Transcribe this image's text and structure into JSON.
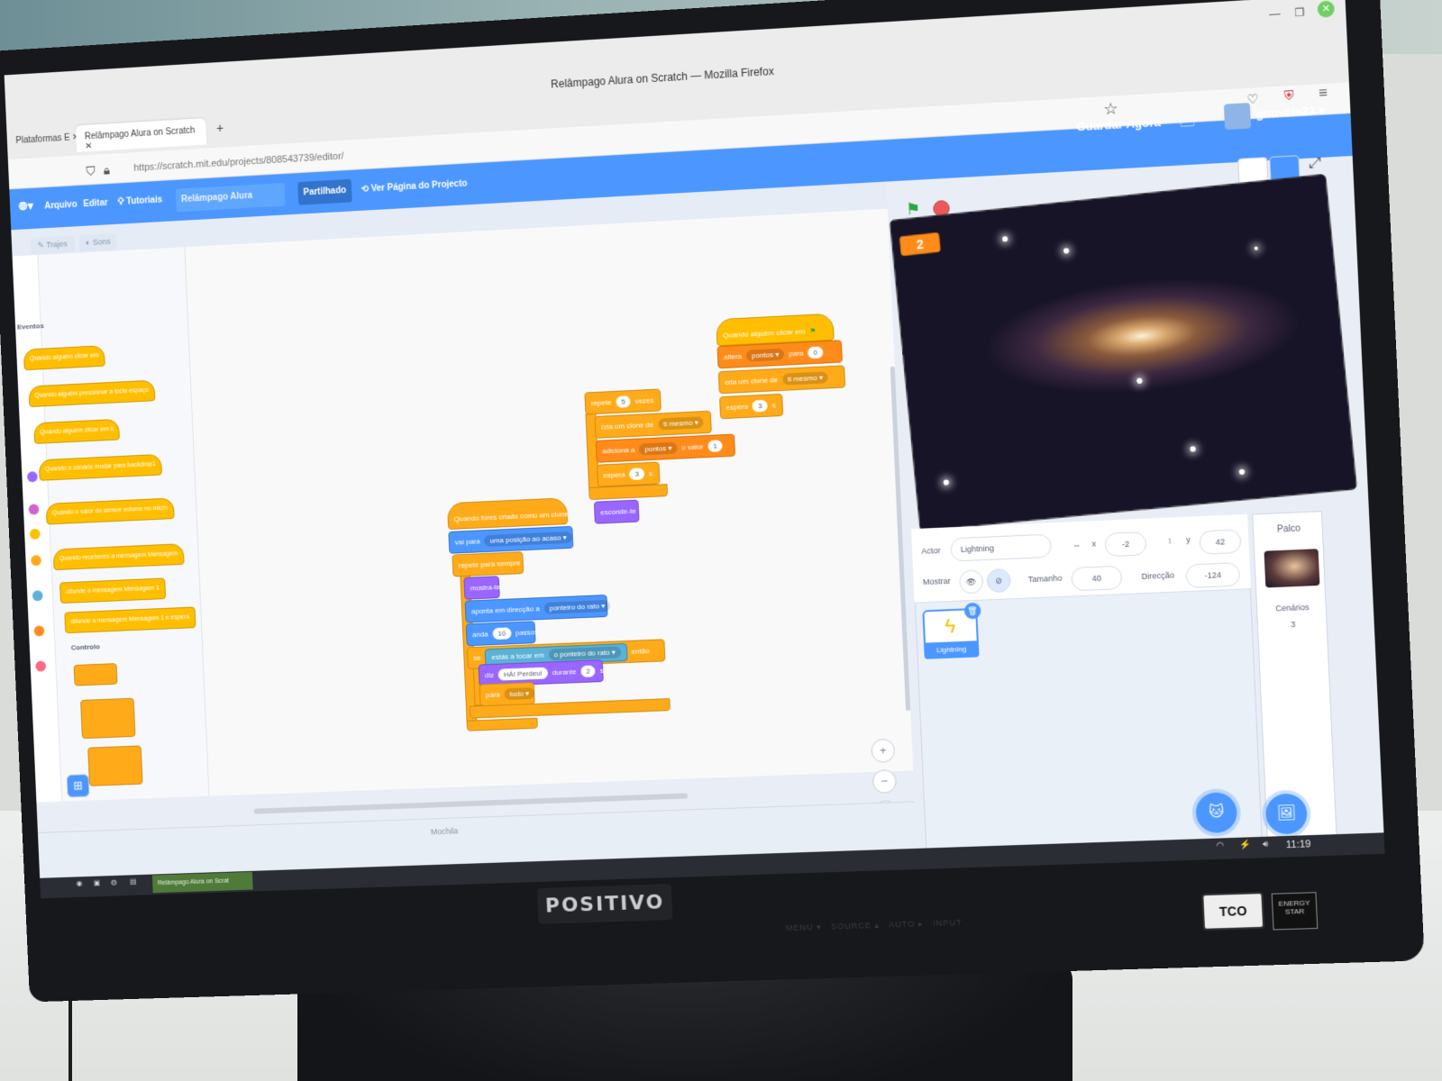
{
  "browser": {
    "window_title": "Relâmpago Alura on Scratch — Mozilla Firefox",
    "tabs": [
      {
        "label": "Plataformas E"
      },
      {
        "label": "Relâmpago Alura on Scratch"
      }
    ],
    "new_tab": "+",
    "url": "https://scratch.mit.edu/projects/808543739/editor/"
  },
  "menubar": {
    "file": "Arquivo",
    "edit": "Editar",
    "tutorials": "Tutoriais",
    "project_title": "Relâmpago Alura",
    "share": "Partilhado",
    "see_page": "Ver Página do Projecto",
    "save_now": "Guardar Agora",
    "username": "gouveia23"
  },
  "editor_tabs": {
    "costumes": "Trajes",
    "sounds": "Sons"
  },
  "palette": {
    "events_label": "Eventos",
    "control_label": "Controlo",
    "events_blocks": [
      "Quando alguém clicar em",
      "Quando alguém pressionar a tecla espaço",
      "Quando alguém clicar em ti",
      "Quando o cenário mudar para backdrop1",
      "Quando o valor do sensor volume no micro",
      "Quando receberes a mensagem Mensagem",
      "difunde a mensagem Mensagem 1",
      "difunde a mensagem Mensagem 1 e espera"
    ],
    "category_labels": [
      "Aparência",
      "Som",
      "Eventos",
      "Controlo",
      "Sensores",
      "Variáveis",
      "Os Meus Blocos"
    ]
  },
  "scripts": {
    "s1": {
      "hat": "Quando alguém clicar em",
      "set_var": "altera",
      "set_var_name": "pontos",
      "set_to": "para",
      "set_value": "0",
      "clone": "cria um clone de",
      "clone_target": "ti mesmo",
      "wait": "espera",
      "wait_value": "3",
      "wait_unit": "s"
    },
    "s2": {
      "repeat": "repete",
      "repeat_value": "5",
      "repeat_unit": "vezes",
      "clone": "cria um clone de",
      "clone_target": "ti mesmo",
      "change": "adiciona a",
      "change_var": "pontos",
      "change_mid": "o valor",
      "change_value": "1",
      "wait": "espera",
      "wait_value": "3",
      "wait_unit": "s",
      "hide": "esconde-te"
    },
    "s3": {
      "hat": "Quando fores criado como um clone",
      "goto": "vai para",
      "goto_target": "uma posição ao acaso",
      "forever": "repete para sempre",
      "show": "mostra-te",
      "point": "aponta em direcção a",
      "point_target": "ponteiro do rato",
      "move": "anda",
      "move_value": "10",
      "move_unit": "passos",
      "if": "se",
      "touching": "estás a tocar em",
      "touching_target": "o ponteiro do rato",
      "then": "então",
      "say": "diz",
      "say_text": "HÁ! Perdeu!",
      "say_mid": "durante",
      "say_value": "2",
      "say_unit": "s",
      "stop": "pára",
      "stop_target": "tudo"
    }
  },
  "workspace": {
    "zoom_in": "+",
    "zoom_out": "−",
    "zoom_reset": "=",
    "backpack": "Mochila"
  },
  "stage": {
    "variable_monitor_value": "2"
  },
  "sprite_info": {
    "sprite_label": "Actor",
    "sprite_name": "Lightning",
    "x_label": "x",
    "x_value": "-2",
    "y_label": "y",
    "y_value": "42",
    "show_label": "Mostrar",
    "size_label": "Tamanho",
    "size_value": "40",
    "direction_label": "Direcção",
    "direction_value": "-124"
  },
  "sprites": [
    {
      "name": "Lightning"
    }
  ],
  "stage_panel": {
    "title": "Palco",
    "backdrops_label": "Cenários",
    "backdrops_count": "3"
  },
  "taskbar": {
    "app": "Relâmpago Alura on Scrat",
    "clock": "11:19"
  },
  "hardware": {
    "brand": "POSITIVO",
    "tco": "TCO",
    "energy": "ENERGY STAR"
  },
  "colors": {
    "scratch_blue": "#4c97ff",
    "events": "#ffbf00",
    "control": "#ffab19",
    "variables": "#ff8c1a",
    "motion": "#4c97ff",
    "looks": "#9966ff",
    "sensing": "#5cb1d6"
  }
}
